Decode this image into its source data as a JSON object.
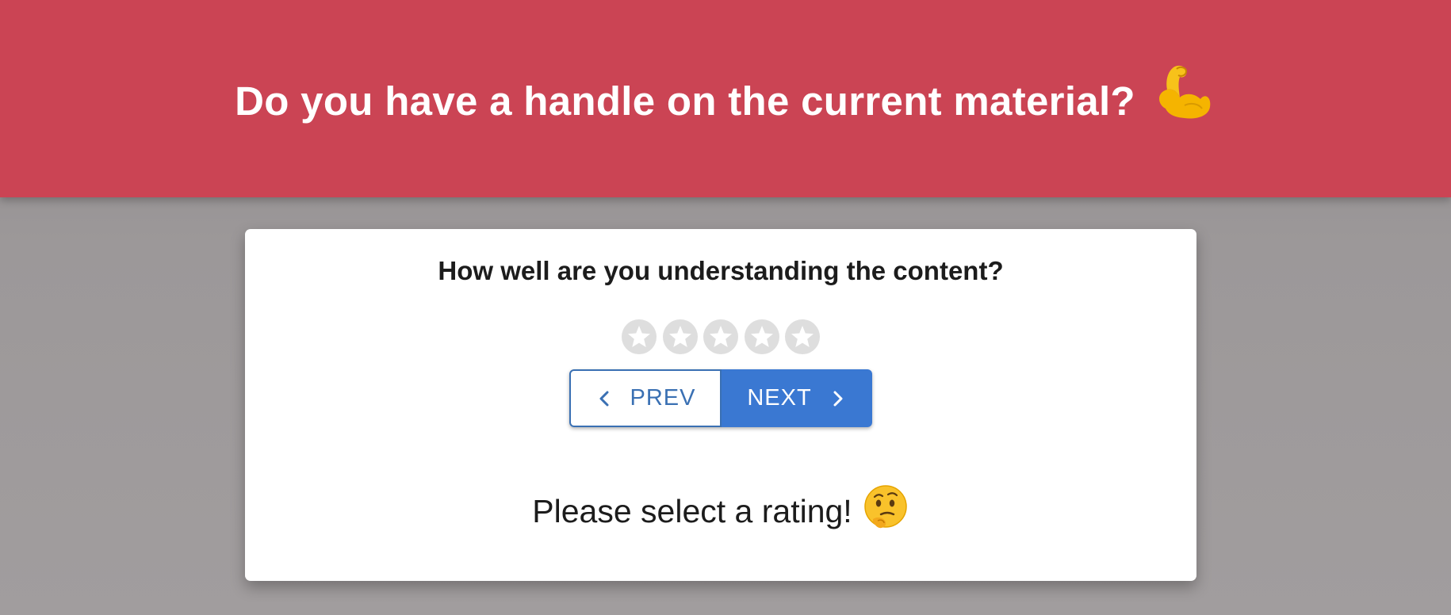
{
  "header": {
    "title": "Do you have a handle on the current material?",
    "title_icon": "flexed-biceps-emoji",
    "background_color": "#cb4454"
  },
  "card": {
    "question": "How well are you understanding the content?",
    "rating": {
      "max": 5,
      "selected": 0,
      "icon": "star-icon",
      "inactive_color": "#dedede"
    },
    "nav": {
      "prev_label": "PREV",
      "next_label": "NEXT",
      "accent_color": "#3a78d2"
    },
    "prompt": "Please select a rating!",
    "prompt_icon": "thinking-face-emoji"
  }
}
